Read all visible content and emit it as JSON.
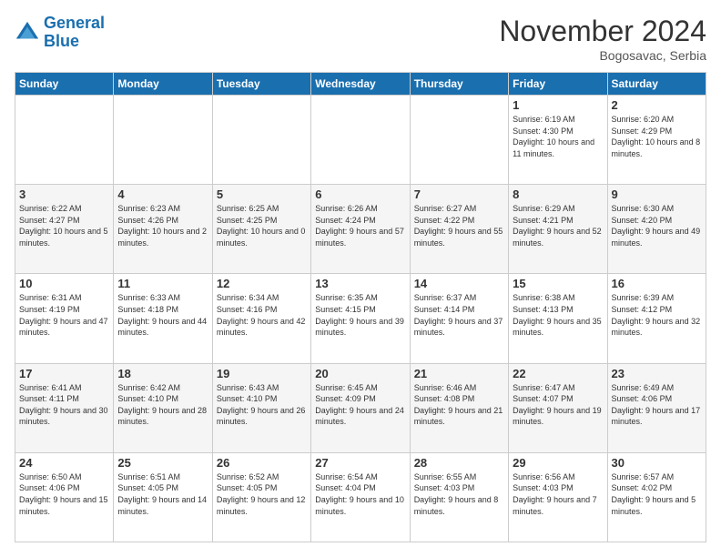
{
  "header": {
    "logo_line1": "General",
    "logo_line2": "Blue",
    "month_title": "November 2024",
    "subtitle": "Bogosavac, Serbia"
  },
  "weekdays": [
    "Sunday",
    "Monday",
    "Tuesday",
    "Wednesday",
    "Thursday",
    "Friday",
    "Saturday"
  ],
  "weeks": [
    [
      {
        "day": "",
        "text": ""
      },
      {
        "day": "",
        "text": ""
      },
      {
        "day": "",
        "text": ""
      },
      {
        "day": "",
        "text": ""
      },
      {
        "day": "",
        "text": ""
      },
      {
        "day": "1",
        "text": "Sunrise: 6:19 AM\nSunset: 4:30 PM\nDaylight: 10 hours and 11 minutes."
      },
      {
        "day": "2",
        "text": "Sunrise: 6:20 AM\nSunset: 4:29 PM\nDaylight: 10 hours and 8 minutes."
      }
    ],
    [
      {
        "day": "3",
        "text": "Sunrise: 6:22 AM\nSunset: 4:27 PM\nDaylight: 10 hours and 5 minutes."
      },
      {
        "day": "4",
        "text": "Sunrise: 6:23 AM\nSunset: 4:26 PM\nDaylight: 10 hours and 2 minutes."
      },
      {
        "day": "5",
        "text": "Sunrise: 6:25 AM\nSunset: 4:25 PM\nDaylight: 10 hours and 0 minutes."
      },
      {
        "day": "6",
        "text": "Sunrise: 6:26 AM\nSunset: 4:24 PM\nDaylight: 9 hours and 57 minutes."
      },
      {
        "day": "7",
        "text": "Sunrise: 6:27 AM\nSunset: 4:22 PM\nDaylight: 9 hours and 55 minutes."
      },
      {
        "day": "8",
        "text": "Sunrise: 6:29 AM\nSunset: 4:21 PM\nDaylight: 9 hours and 52 minutes."
      },
      {
        "day": "9",
        "text": "Sunrise: 6:30 AM\nSunset: 4:20 PM\nDaylight: 9 hours and 49 minutes."
      }
    ],
    [
      {
        "day": "10",
        "text": "Sunrise: 6:31 AM\nSunset: 4:19 PM\nDaylight: 9 hours and 47 minutes."
      },
      {
        "day": "11",
        "text": "Sunrise: 6:33 AM\nSunset: 4:18 PM\nDaylight: 9 hours and 44 minutes."
      },
      {
        "day": "12",
        "text": "Sunrise: 6:34 AM\nSunset: 4:16 PM\nDaylight: 9 hours and 42 minutes."
      },
      {
        "day": "13",
        "text": "Sunrise: 6:35 AM\nSunset: 4:15 PM\nDaylight: 9 hours and 39 minutes."
      },
      {
        "day": "14",
        "text": "Sunrise: 6:37 AM\nSunset: 4:14 PM\nDaylight: 9 hours and 37 minutes."
      },
      {
        "day": "15",
        "text": "Sunrise: 6:38 AM\nSunset: 4:13 PM\nDaylight: 9 hours and 35 minutes."
      },
      {
        "day": "16",
        "text": "Sunrise: 6:39 AM\nSunset: 4:12 PM\nDaylight: 9 hours and 32 minutes."
      }
    ],
    [
      {
        "day": "17",
        "text": "Sunrise: 6:41 AM\nSunset: 4:11 PM\nDaylight: 9 hours and 30 minutes."
      },
      {
        "day": "18",
        "text": "Sunrise: 6:42 AM\nSunset: 4:10 PM\nDaylight: 9 hours and 28 minutes."
      },
      {
        "day": "19",
        "text": "Sunrise: 6:43 AM\nSunset: 4:10 PM\nDaylight: 9 hours and 26 minutes."
      },
      {
        "day": "20",
        "text": "Sunrise: 6:45 AM\nSunset: 4:09 PM\nDaylight: 9 hours and 24 minutes."
      },
      {
        "day": "21",
        "text": "Sunrise: 6:46 AM\nSunset: 4:08 PM\nDaylight: 9 hours and 21 minutes."
      },
      {
        "day": "22",
        "text": "Sunrise: 6:47 AM\nSunset: 4:07 PM\nDaylight: 9 hours and 19 minutes."
      },
      {
        "day": "23",
        "text": "Sunrise: 6:49 AM\nSunset: 4:06 PM\nDaylight: 9 hours and 17 minutes."
      }
    ],
    [
      {
        "day": "24",
        "text": "Sunrise: 6:50 AM\nSunset: 4:06 PM\nDaylight: 9 hours and 15 minutes."
      },
      {
        "day": "25",
        "text": "Sunrise: 6:51 AM\nSunset: 4:05 PM\nDaylight: 9 hours and 14 minutes."
      },
      {
        "day": "26",
        "text": "Sunrise: 6:52 AM\nSunset: 4:05 PM\nDaylight: 9 hours and 12 minutes."
      },
      {
        "day": "27",
        "text": "Sunrise: 6:54 AM\nSunset: 4:04 PM\nDaylight: 9 hours and 10 minutes."
      },
      {
        "day": "28",
        "text": "Sunrise: 6:55 AM\nSunset: 4:03 PM\nDaylight: 9 hours and 8 minutes."
      },
      {
        "day": "29",
        "text": "Sunrise: 6:56 AM\nSunset: 4:03 PM\nDaylight: 9 hours and 7 minutes."
      },
      {
        "day": "30",
        "text": "Sunrise: 6:57 AM\nSunset: 4:02 PM\nDaylight: 9 hours and 5 minutes."
      }
    ]
  ]
}
